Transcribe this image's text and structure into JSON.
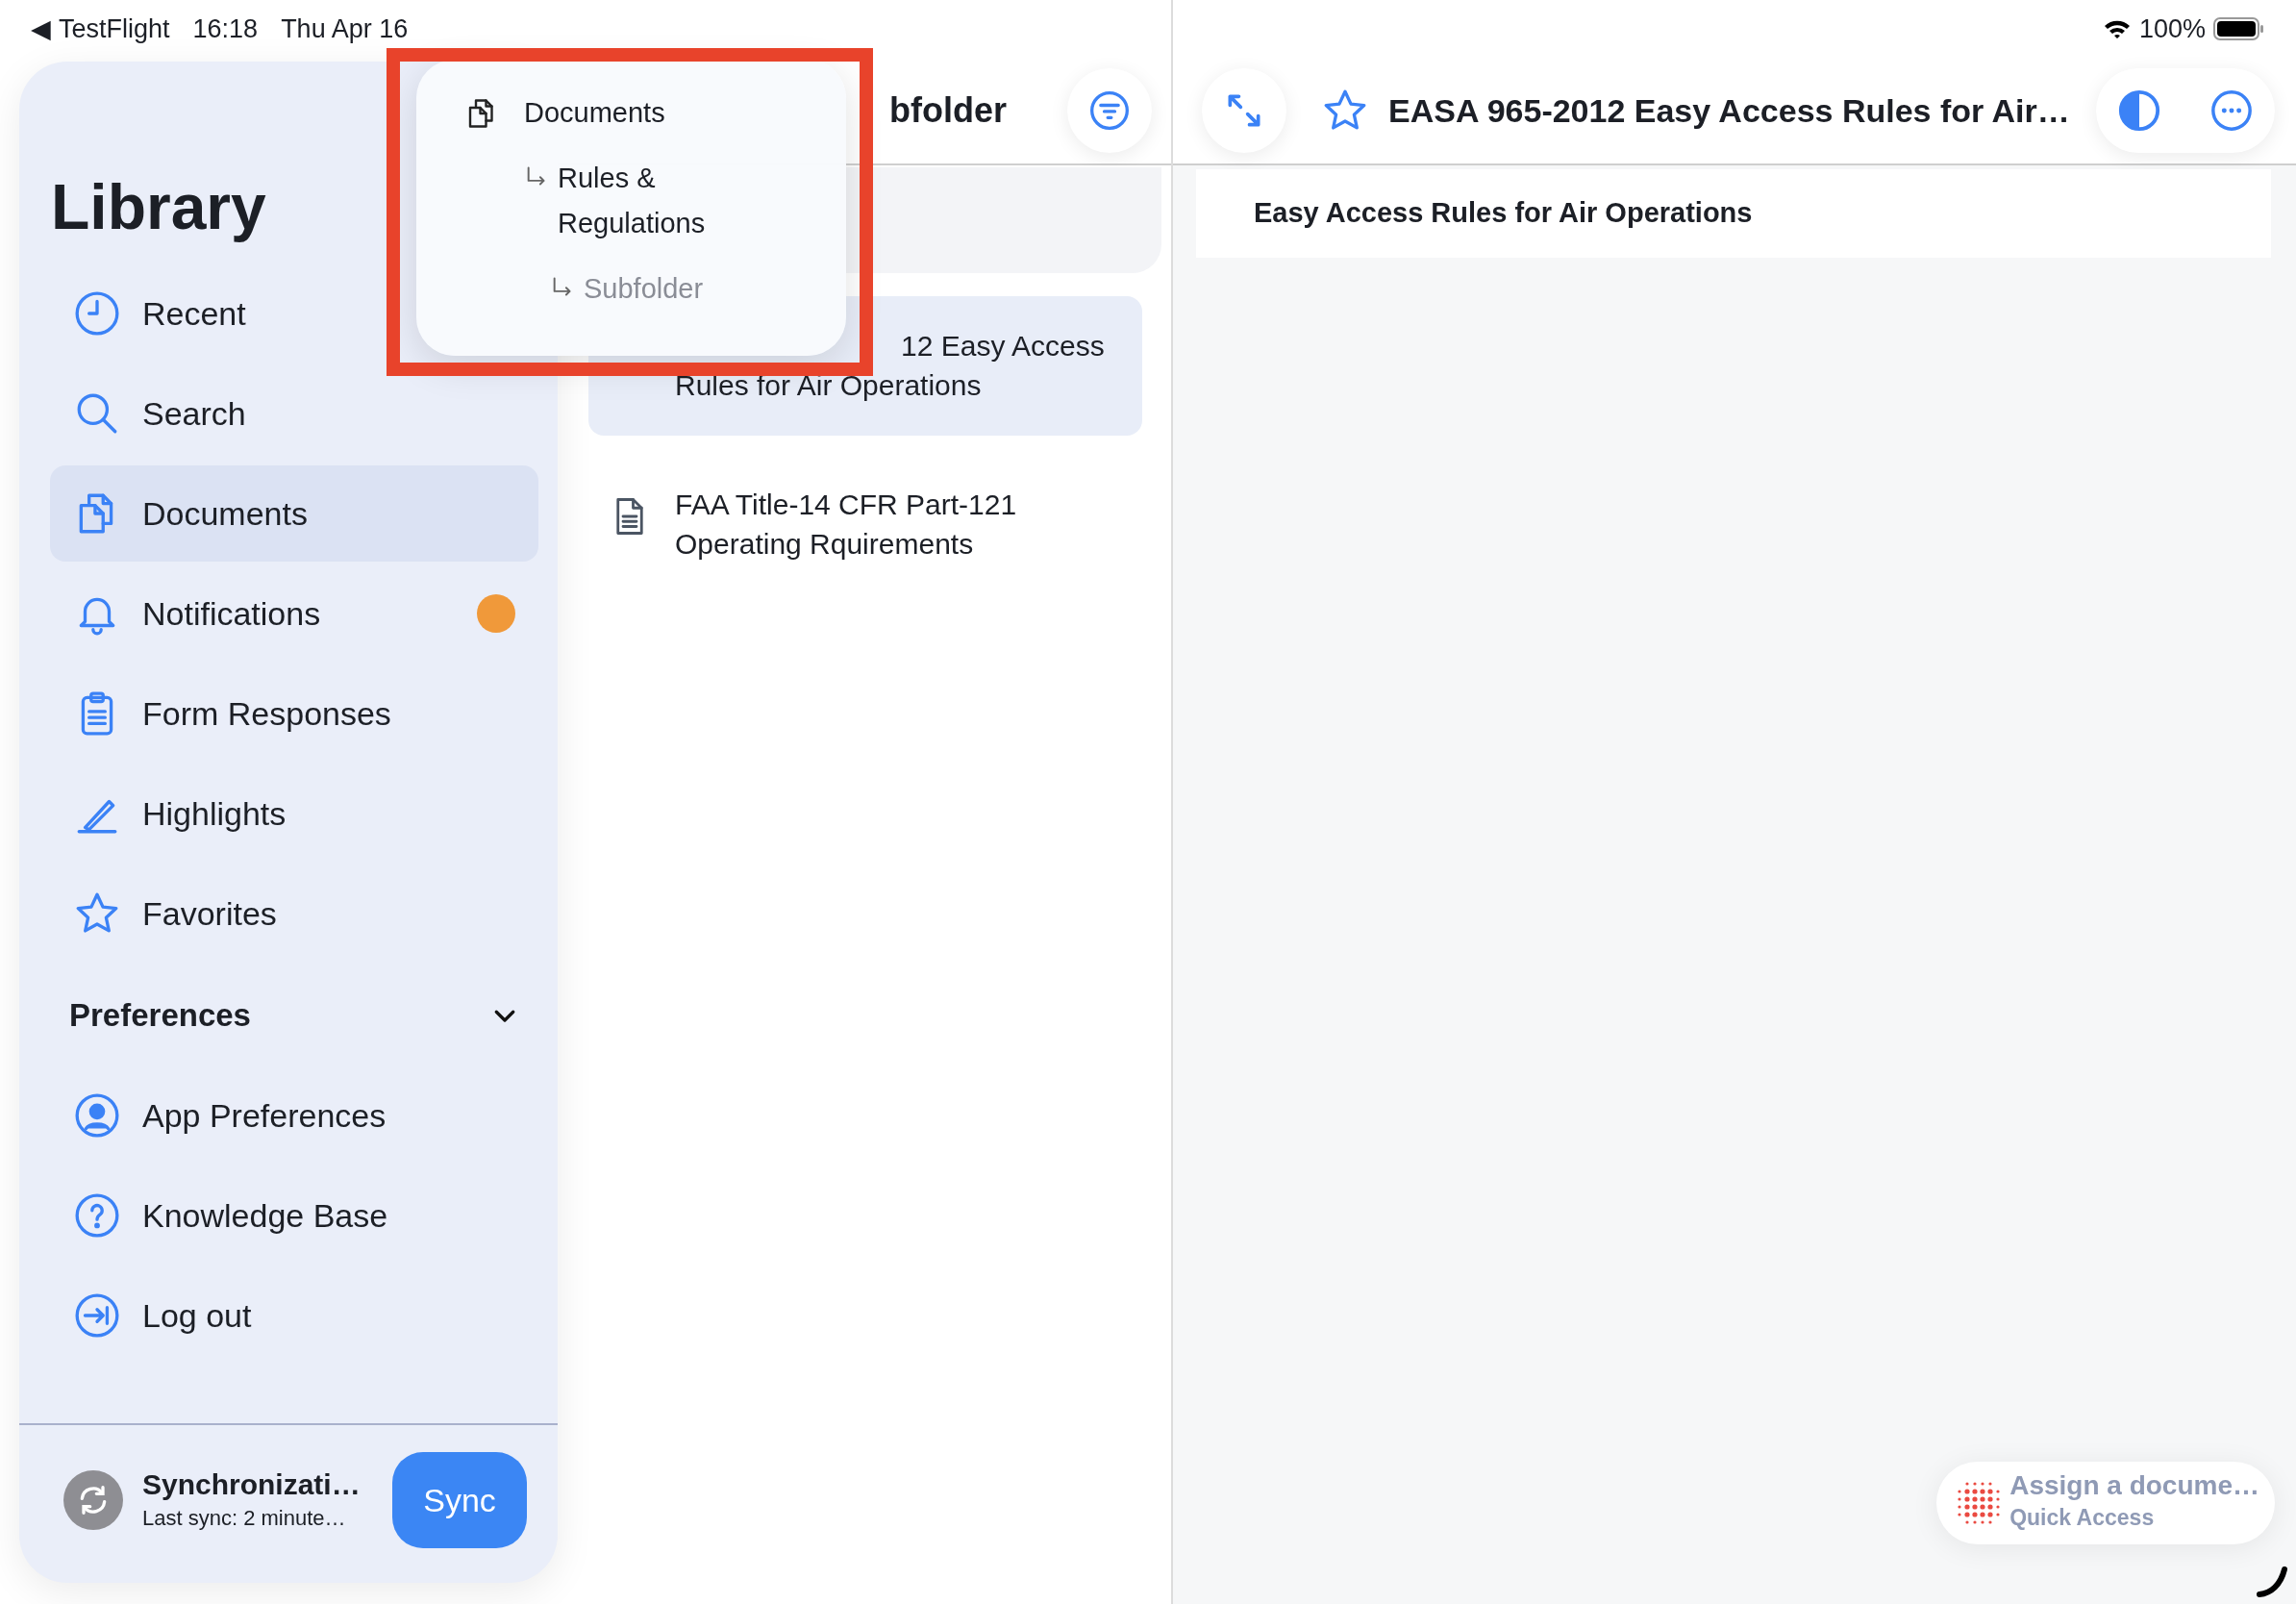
{
  "status_bar": {
    "back_arrow": "◀",
    "back_app": "TestFlight",
    "time": "16:18",
    "date": "Thu Apr 16",
    "battery": "100%"
  },
  "sidebar": {
    "title": "Library",
    "items": [
      {
        "label": "Recent",
        "selected": false,
        "badge": false
      },
      {
        "label": "Search",
        "selected": false,
        "badge": false
      },
      {
        "label": "Documents",
        "selected": true,
        "badge": false
      },
      {
        "label": "Notifications",
        "selected": false,
        "badge": true
      },
      {
        "label": "Form Responses",
        "selected": false,
        "badge": false
      },
      {
        "label": "Highlights",
        "selected": false,
        "badge": false
      },
      {
        "label": "Favorites",
        "selected": false,
        "badge": false
      }
    ],
    "section": {
      "title": "Preferences",
      "expanded": true,
      "items": [
        {
          "label": "App Preferences"
        },
        {
          "label": "Knowledge Base"
        },
        {
          "label": "Log out"
        }
      ]
    },
    "sync": {
      "title": "Synchronizati…",
      "subtitle": "Last sync: 2 minute…",
      "button": "Sync"
    }
  },
  "middle": {
    "title": "bfolder",
    "documents": [
      {
        "lines": [
          "12 Easy Access",
          "Rules for Air Operations"
        ],
        "selected": true,
        "covered": true
      },
      {
        "lines": [
          "FAA Title-14 CFR Part-121",
          "Operating Rquirements"
        ],
        "selected": false,
        "covered": false
      }
    ]
  },
  "path_menu": {
    "items": [
      {
        "label": "Documents",
        "current": false,
        "children": [
          {
            "label": "Rules & Regulations",
            "current": false,
            "children": [
              {
                "label": "Subfolder",
                "current": true
              }
            ]
          }
        ]
      }
    ]
  },
  "viewer": {
    "title": "EASA 965-2012 Easy Access Rules for Air…",
    "favorite": false,
    "heading": "Easy Access Rules for Air Operations"
  },
  "quick_access": {
    "title": "Assign a docume…",
    "subtitle": "Quick Access"
  }
}
